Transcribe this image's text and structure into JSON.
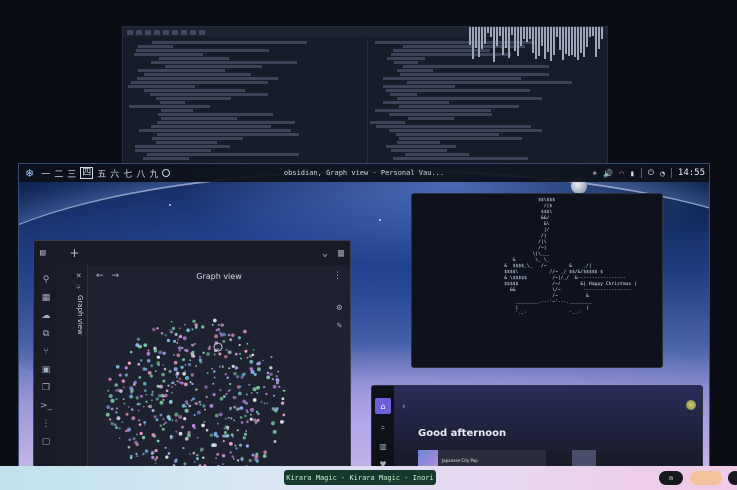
{
  "topbar": {
    "workspaces": [
      "一",
      "二",
      "三",
      "四",
      "五",
      "六",
      "七",
      "八",
      "九"
    ],
    "active_workspace": "四",
    "window_title": "obsidian, Graph view - Personal Vau...",
    "clock": "14:55"
  },
  "obsidian": {
    "graph_title": "Graph view",
    "side_tab_label": "Graph view"
  },
  "terminal": {
    "ascii_art": "                      $$\\$$$\n                        /|$\n                       $$$\\\n                       &&/\n                        &\\\n                        |/\n                       /|\n                      /|\\\n                      /~|\n                    \\|\\___\n             &       \\_ \\_\n          &  $$$$_\\_   /~        &    _/|\n          $$$$\\           //~ _/ $$/&/$$$$$ $\n          & \\$$$$$         /~|/_/  &-----------------\n          $$$$$            /~/       &| Happy Christmas |\n            &&             \\/~        -----------------\n                           /~          &\n              ________.---'~'---.________\n              |                        |\n              `--'               `--'"
  },
  "spotify": {
    "greeting": "Good afternoon",
    "card_label": "Japanese City Pop"
  },
  "bottombar": {
    "now_playing": "Kirara Magic - Kirara Magic - Inori",
    "pill_label": "m"
  },
  "colors": {
    "accent": "#6d5fd8",
    "now_playing_bg": "#15392c"
  }
}
